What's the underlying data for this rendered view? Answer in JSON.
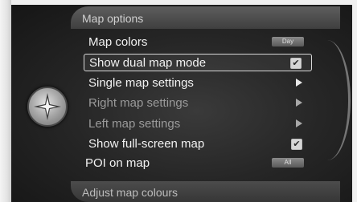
{
  "header": {
    "title": "Map options"
  },
  "menu": {
    "items": [
      {
        "label": "Map colors",
        "control": "badge",
        "badge": "Day"
      },
      {
        "label": "Show dual map mode",
        "control": "checkbox",
        "checked": true
      },
      {
        "label": "Single map settings",
        "control": "arrow"
      },
      {
        "label": "Right map settings",
        "control": "arrow",
        "disabled": true
      },
      {
        "label": "Left map settings",
        "control": "arrow",
        "disabled": true
      },
      {
        "label": "Show full-screen map",
        "control": "checkbox",
        "checked": true
      },
      {
        "label": "POI on map",
        "control": "badge",
        "badge": "All"
      }
    ]
  },
  "footer": {
    "label": "Adjust map colours"
  },
  "icons": {
    "knob": "navigation-knob-icon",
    "check": "✔"
  },
  "colors": {
    "selection": "#d8d8d8",
    "background": "#262626"
  }
}
